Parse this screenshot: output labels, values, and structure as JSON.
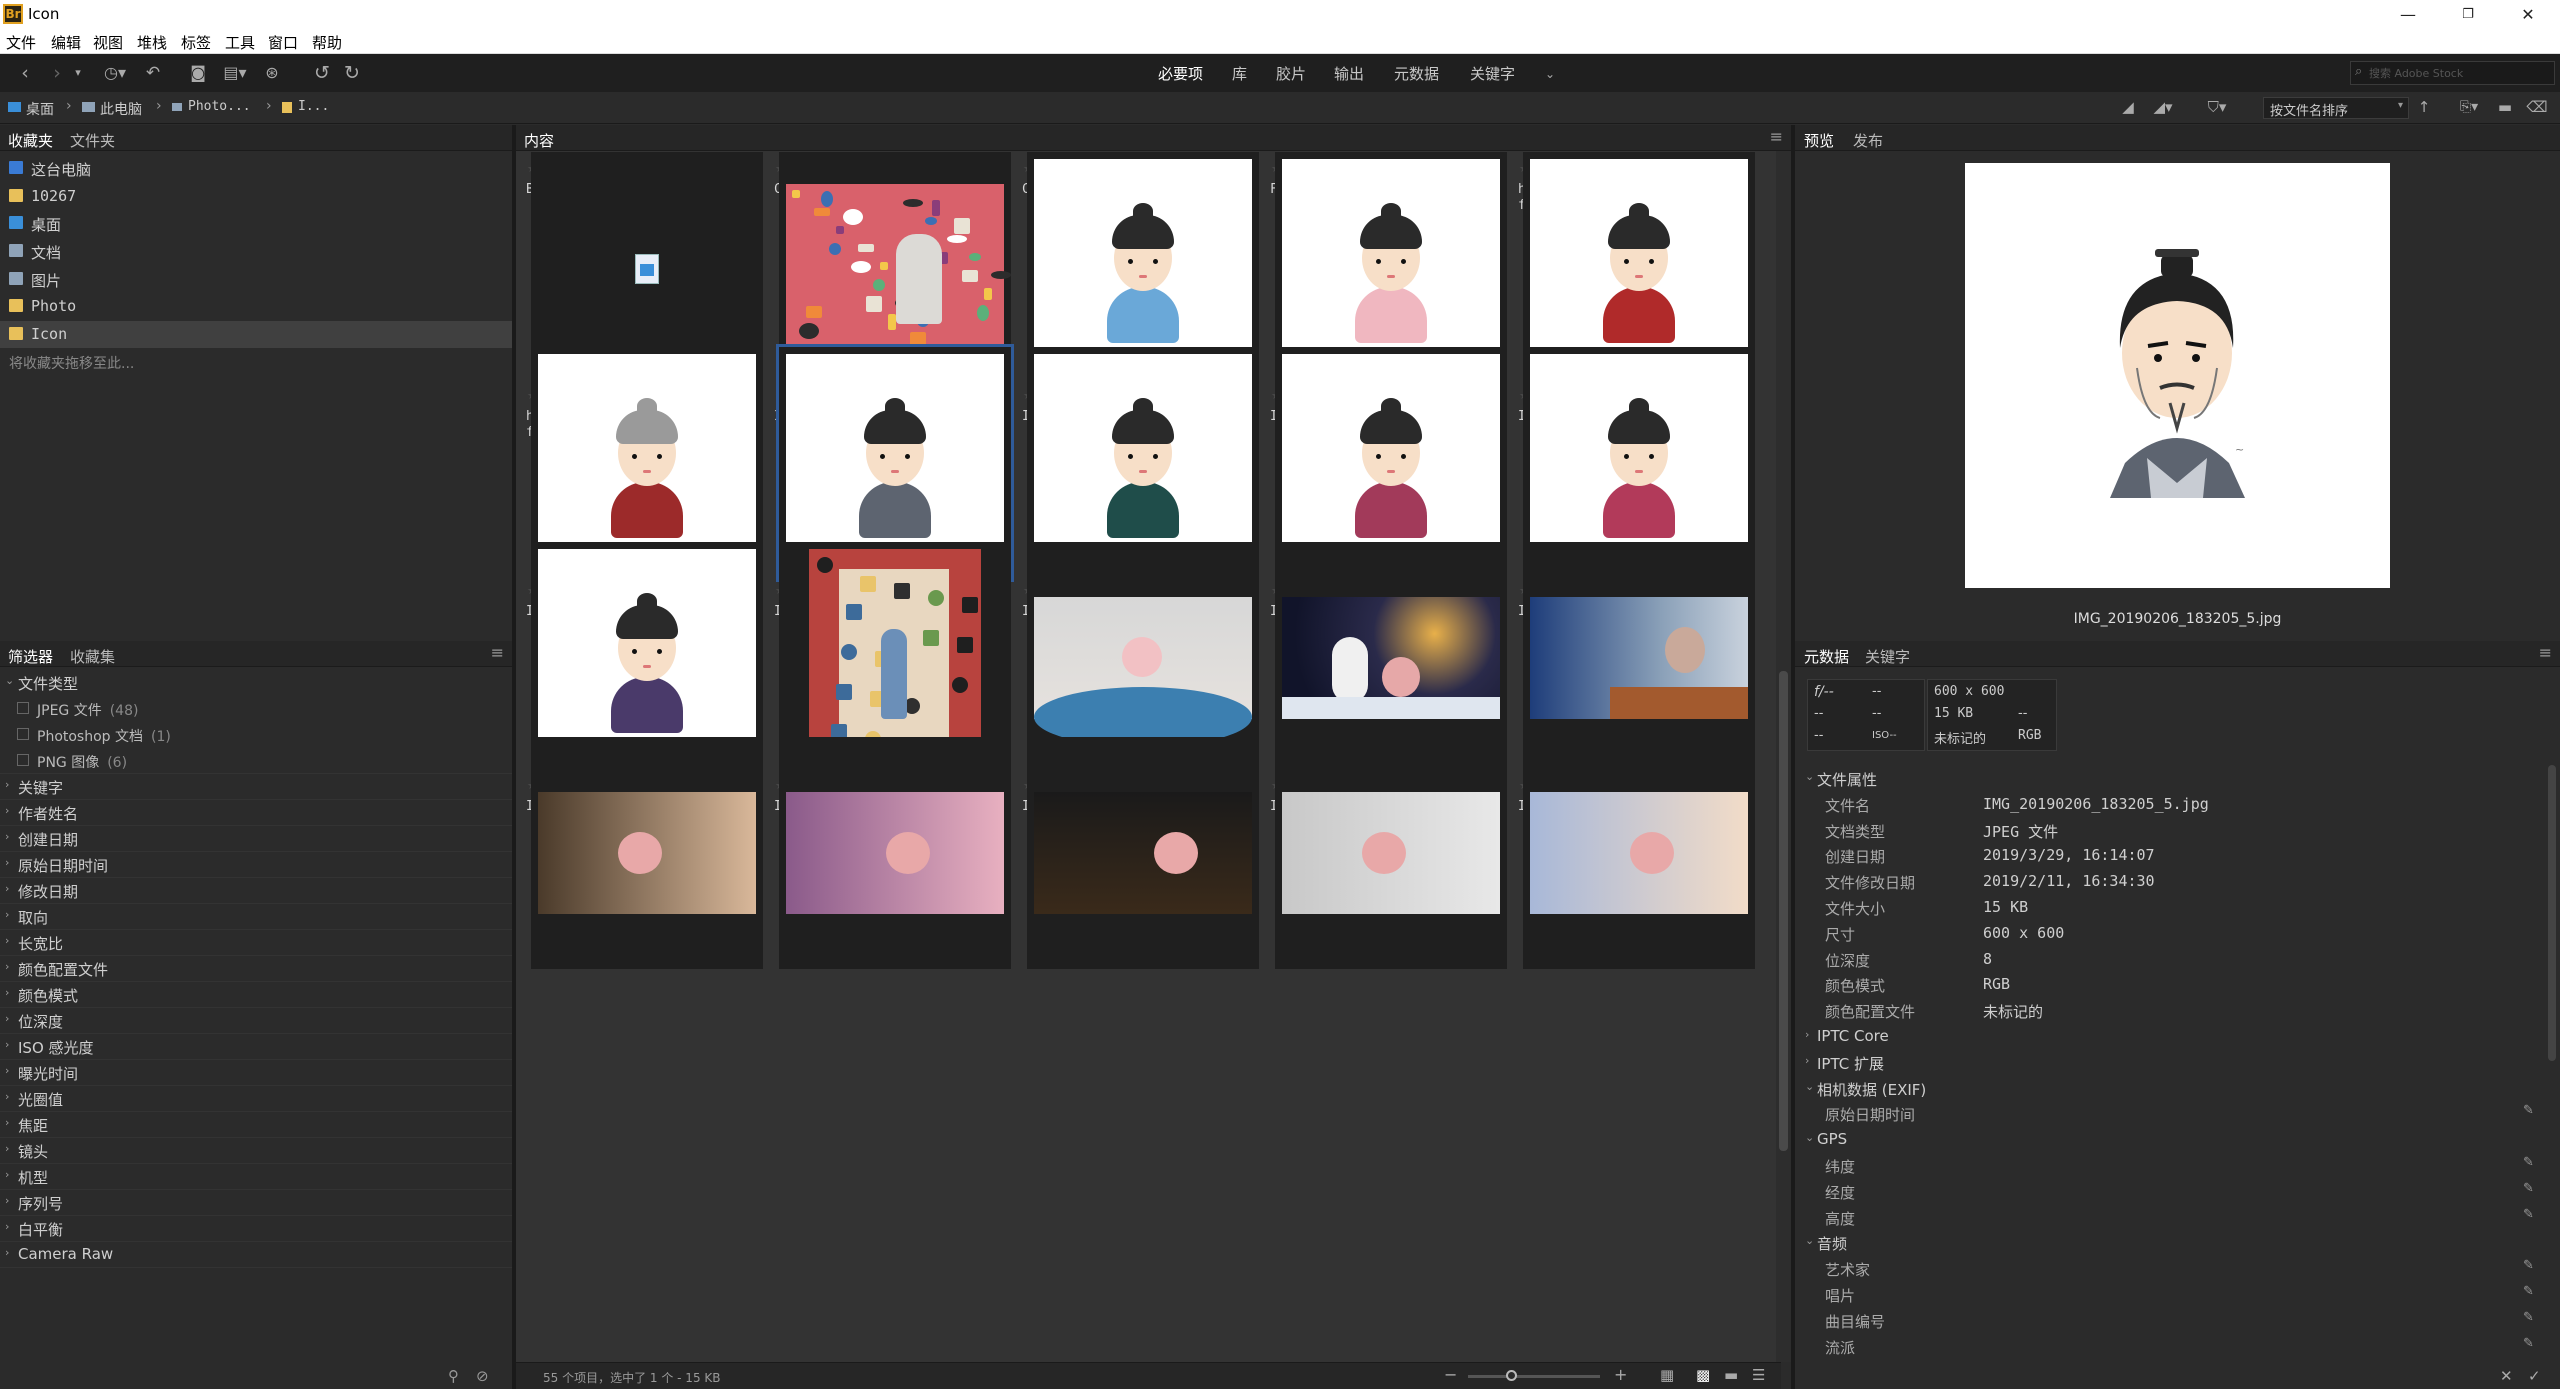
{
  "window": {
    "title": "Icon",
    "minimize": "—",
    "maximize": "❐",
    "close": "✕"
  },
  "menu": [
    "文件",
    "编辑",
    "视图",
    "堆栈",
    "标签",
    "工具",
    "窗口",
    "帮助"
  ],
  "workspaces": [
    "必要项",
    "库",
    "胶片",
    "输出",
    "元数据",
    "关键字"
  ],
  "search": {
    "placeholder": "搜索 Adobe Stock"
  },
  "path": {
    "crumbs": [
      "桌面",
      "此电脑",
      "Photo...",
      "I..."
    ]
  },
  "sort": {
    "label": "按文件名排序"
  },
  "favorites": {
    "tabs": [
      "收藏夹",
      "文件夹"
    ],
    "items": [
      {
        "label": "这台电脑",
        "color": "#3a7bd5"
      },
      {
        "label": "10267",
        "color": "#e8c05a"
      },
      {
        "label": "桌面",
        "color": "#3a8fd9"
      },
      {
        "label": "文档",
        "color": "#8fa3b8"
      },
      {
        "label": "图片",
        "color": "#8fa3b8"
      },
      {
        "label": "Photo",
        "color": "#e8c05a"
      },
      {
        "label": "Icon",
        "color": "#e8c05a"
      }
    ],
    "hint": "将收藏夹拖移至此..."
  },
  "filter": {
    "tabs": [
      "筛选器",
      "收藏集"
    ],
    "file_type_header": "文件类型",
    "file_types": [
      {
        "label": "JPEG 文件",
        "count": "(48)"
      },
      {
        "label": "Photoshop 文档",
        "count": "(1)"
      },
      {
        "label": "PNG 图像",
        "count": "(6)"
      }
    ],
    "categories": [
      "关键字",
      "作者姓名",
      "创建日期",
      "原始日期时间",
      "修改日期",
      "取向",
      "长宽比",
      "颜色配置文件",
      "颜色模式",
      "位深度",
      "ISO 感光度",
      "曝光时间",
      "光圈值",
      "焦距",
      "镜头",
      "机型",
      "序列号",
      "白平衡",
      "Camera Raw"
    ]
  },
  "content": {
    "tab": "内容",
    "stars": "★★★★★",
    "top_row": [
      "Bitmoji.psd",
      "Cartoon_icon.jpg",
      "Creative Commons.png",
      "FuckIt.jpg",
      "hdImg_0705fad3cdc02443ac0c169cf6d7339a1530947735118.jpg"
    ],
    "rows": [
      [
        "hdImg_0705fad3cdc02443ac0c169cf6d7339a1551589430449.jpg",
        "IMG_20190202_121716_8.jpg",
        "IMG_20190206_183204_1.jpg",
        "IMG_20190206_183204_2.jpg",
        "IMG_20190206_183204_3.jpg"
      ],
      [
        "IMG_20190206_183205_4.jpg",
        "IMG_20190206_183205_5.jpg",
        "IMG_20190206_183205_6.jpg",
        "IMG_20190206_183205_7.jpg",
        "IMG_20190206_183205_8.jpg"
      ],
      [
        "IMG_20190206_183206_9.jpg",
        "IMG_20190219_114328_1.jpg",
        "IMG_20190302_135238_1.jpg",
        "IMG_20190302_135240_2.jpg",
        "IMG_20190302_135241_3.jpg"
      ]
    ],
    "status": "55 个项目，选中了 1 个 - 15 KB"
  },
  "preview": {
    "tabs": [
      "预览",
      "发布"
    ],
    "caption": "IMG_20190206_183205_5.jpg"
  },
  "metadata": {
    "tabs": [
      "元数据",
      "关键字"
    ],
    "summary": {
      "f": "f/--",
      "dash": "--",
      "iso": "ISO--",
      "dims": "600 x 600",
      "size": "15 KB",
      "profile": "未标记的",
      "mode": "RGB"
    },
    "file_props_header": "文件属性",
    "file_props": [
      {
        "k": "文件名",
        "v": "IMG_20190206_183205_5.jpg"
      },
      {
        "k": "文档类型",
        "v": "JPEG 文件"
      },
      {
        "k": "创建日期",
        "v": "2019/3/29, 16:14:07"
      },
      {
        "k": "文件修改日期",
        "v": "2019/2/11, 16:34:30"
      },
      {
        "k": "文件大小",
        "v": "15 KB"
      },
      {
        "k": "尺寸",
        "v": "600 x 600"
      },
      {
        "k": "位深度",
        "v": "8"
      },
      {
        "k": "颜色模式",
        "v": "RGB"
      },
      {
        "k": "颜色配置文件",
        "v": "未标记的"
      }
    ],
    "sections": [
      "IPTC Core",
      "IPTC 扩展",
      "相机数据 (EXIF)",
      "GPS",
      "音频"
    ],
    "exif_field": "原始日期时间",
    "gps_fields": [
      "纬度",
      "经度",
      "高度"
    ],
    "audio_fields": [
      "艺术家",
      "唱片",
      "曲目编号",
      "流派"
    ]
  }
}
